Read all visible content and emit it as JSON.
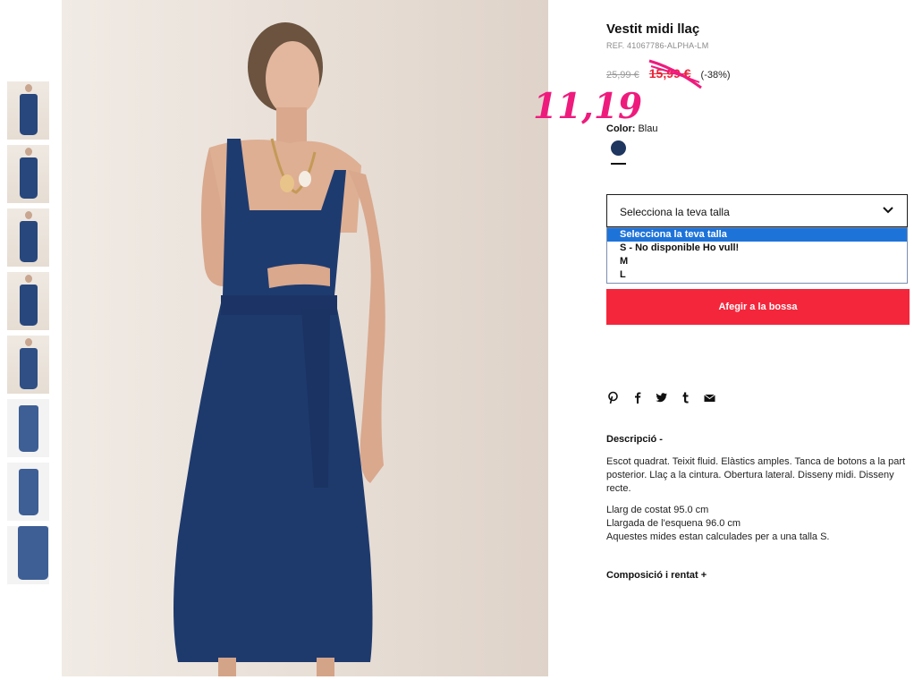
{
  "product": {
    "title": "Vestit midi llaç",
    "ref": "REF. 41067786-ALPHA-LM",
    "old_price": "25,99 €",
    "new_price": "15,99 €",
    "discount": "(-38%)",
    "handwritten_price": "11,19",
    "color_label": "Color:",
    "color_value": "Blau",
    "swatch_color": "#1e3660"
  },
  "size_select": {
    "value": "Selecciona la teva talla",
    "options": [
      "Selecciona la teva talla",
      "S - No disponible Ho vull!",
      "M",
      "L"
    ],
    "selected_index": 0
  },
  "add_button": {
    "label": "Afegir a la bossa"
  },
  "share_icons": [
    "pinterest-icon",
    "facebook-icon",
    "twitter-icon",
    "tumblr-icon",
    "mail-icon"
  ],
  "description": {
    "title": "Descripció -",
    "text": "Escot quadrat. Teixit fluid. Elàstics amples. Tanca de botons a la part posterior. Llaç a la cintura. Obertura lateral. Disseny midi. Disseny recte.",
    "measures": [
      "Llarg de costat 95.0 cm",
      "Llargada de l'esquena 96.0 cm",
      "Aquestes mides estan calculades per a una talla S."
    ]
  },
  "composition": {
    "title": "Composició i rentat +"
  },
  "colors": {
    "accent": "#f4263b",
    "dress": "#1e3660"
  }
}
